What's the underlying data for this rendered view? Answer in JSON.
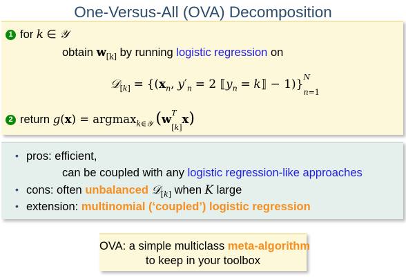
{
  "title": "One-Versus-All (OVA) Decomposition",
  "algorithm": {
    "step1_number": "1",
    "step1_text": "for k ∈ 𝒴",
    "obtain_prefix": "obtain",
    "obtain_weight": "w",
    "obtain_subscript": "[k]",
    "obtain_mid": "by running",
    "obtain_link": "logistic regression",
    "obtain_suffix": "on",
    "formula": "𝒟[k] = {(xn, y′n = 2 ⟦yn = k⟧ − 1)}N n=1",
    "step2_number": "2",
    "step2_prefix": "return",
    "step2_formula": "g(x) = argmax k∈𝒴 (wT[k] x)"
  },
  "pros_cons": {
    "pros_label": "pros: efficient,",
    "pros_continuation": "can be coupled with any",
    "pros_link": "logistic regression-like approaches",
    "cons_prefix": "cons: often",
    "cons_highlight": "unbalanced",
    "cons_math": "𝒟[k]",
    "cons_suffix": "when K large",
    "extension_prefix": "extension:",
    "extension_highlight": "multinomial (‘coupled’) logistic regression"
  },
  "takeaway": {
    "line1_prefix": "OVA: a simple multiclass",
    "line1_highlight": "meta-algorithm",
    "line2": "to keep in your toolbox"
  },
  "colors": {
    "title": "#2e4d6b",
    "link_blue": "#1f1fe0",
    "highlight_orange": "#f58f1f",
    "step_badge_green": "#0a8a0a",
    "algo_box": "#fdf8d9",
    "pros_box": "#e5f0ec"
  }
}
